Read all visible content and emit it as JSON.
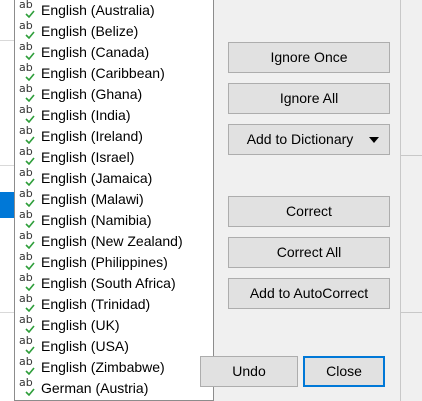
{
  "languages": [
    {
      "label": "English (Australia)"
    },
    {
      "label": "English (Belize)"
    },
    {
      "label": "English (Canada)"
    },
    {
      "label": "English (Caribbean)"
    },
    {
      "label": "English (Ghana)"
    },
    {
      "label": "English (India)"
    },
    {
      "label": "English (Ireland)"
    },
    {
      "label": "English (Israel)"
    },
    {
      "label": "English (Jamaica)"
    },
    {
      "label": "English (Malawi)"
    },
    {
      "label": "English (Namibia)"
    },
    {
      "label": "English (New Zealand)"
    },
    {
      "label": "English (Philippines)"
    },
    {
      "label": "English (South Africa)"
    },
    {
      "label": "English (Trinidad)"
    },
    {
      "label": "English (UK)"
    },
    {
      "label": "English (USA)"
    },
    {
      "label": "English (Zimbabwe)"
    },
    {
      "label": "German (Austria)"
    }
  ],
  "language_icon_text": "ab",
  "buttons": {
    "ignore_once": "Ignore Once",
    "ignore_all": "Ignore All",
    "add_to_dictionary": "Add to Dictionary",
    "correct": "Correct",
    "correct_all": "Correct All",
    "add_to_autocorrect": "Add to AutoCorrect",
    "undo": "Undo",
    "close": "Close"
  },
  "colors": {
    "selection": "#0078d7",
    "check_green": "#2e9e3a",
    "button_face": "#e1e1e1"
  }
}
